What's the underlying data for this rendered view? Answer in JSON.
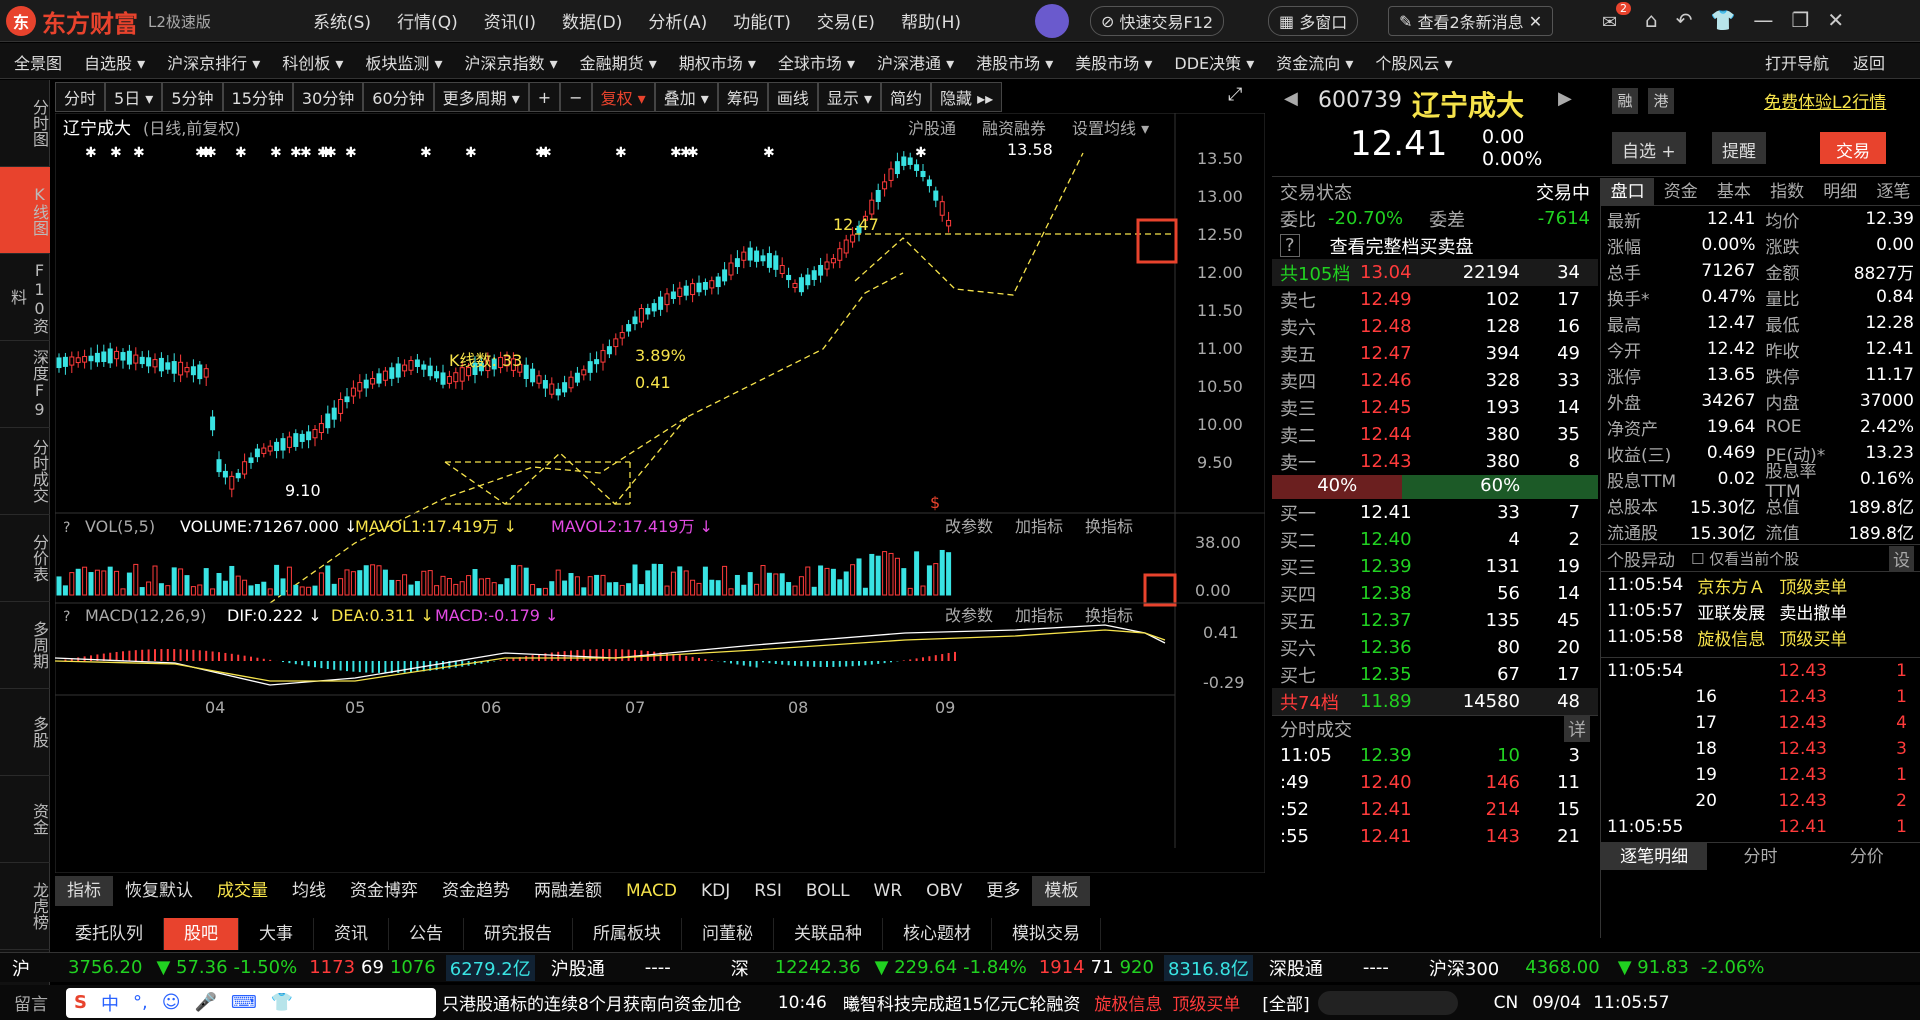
{
  "titlebar": {
    "brand": "东方财富",
    "edition": "L2极速版",
    "menus": [
      "系统(S)",
      "行情(Q)",
      "资讯(I)",
      "数据(D)",
      "分析(A)",
      "功能(T)",
      "交易(E)",
      "帮助(H)"
    ],
    "quick_trade": "快速交易F12",
    "multi_window": "多窗口",
    "news": "查看2条新消息",
    "badge": "2"
  },
  "navbar": [
    "全景图",
    "自选股 ▾",
    "沪深京排行 ▾",
    "科创板 ▾",
    "板块监测 ▾",
    "沪深京指数 ▾",
    "金融期货 ▾",
    "期权市场 ▾",
    "全球市场 ▾",
    "沪深港通 ▾",
    "港股市场 ▾",
    "美股市场 ▾",
    "DDE决策 ▾",
    "资金流向 ▾",
    "个股风云 ▾"
  ],
  "navbar_right": [
    "打开导航",
    "返回"
  ],
  "leftbar": [
    "分时图",
    "K线图",
    "F10资料",
    "深度F9",
    "分时成交",
    "分价表",
    "多周期",
    "多股",
    "资金",
    "龙虎榜"
  ],
  "chart_toolbar": [
    "分时",
    "5日 ▾",
    "5分钟",
    "15分钟",
    "30分钟",
    "60分钟",
    "更多周期 ▾",
    "+",
    "−",
    "复权 ▾",
    "叠加 ▾",
    "筹码",
    "画线",
    "显示 ▾",
    "简约",
    "隐藏 ▸▸"
  ],
  "chart_header": {
    "name": "辽宁成大",
    "mode": "(日线,前复权)",
    "links": [
      "沪股通",
      "融资融券",
      "设置均线 ▾"
    ]
  },
  "chart_data": {
    "type": "candlestick",
    "y_ticks": [
      "13.50",
      "13.00",
      "12.50",
      "12.00",
      "11.50",
      "11.00",
      "10.50",
      "10.00",
      "9.50"
    ],
    "x_ticks": [
      "04",
      "05",
      "06",
      "07",
      "08",
      "09"
    ],
    "annotations": [
      "13.58",
      "12.47",
      "K线数: 33",
      "3.89%",
      "0.41",
      "9.10"
    ],
    "high": 13.58,
    "low": 9.1
  },
  "vol_header": {
    "name": "VOL(5,5)",
    "volume": "VOLUME:71267.000 ↓",
    "ma1": "MAVOL1:17.419万 ↓",
    "ma2": "MAVOL2:17.419万 ↓",
    "actions": [
      "改参数",
      "加指标",
      "换指标"
    ]
  },
  "vol_axis": [
    "38.00",
    "0.00"
  ],
  "macd_header": {
    "name": "MACD(12,26,9)",
    "dif": "DIF:0.222 ↓",
    "dea": "DEA:0.311 ↓",
    "macd": "MACD:-0.179 ↓",
    "actions": [
      "改参数",
      "加指标",
      "换指标"
    ]
  },
  "macd_axis": [
    "0.41",
    "-0.29"
  ],
  "indicators": [
    "指标",
    "恢复默认",
    "成交量",
    "均线",
    "资金博弈",
    "资金趋势",
    "两融差额",
    "MACD",
    "KDJ",
    "RSI",
    "BOLL",
    "WR",
    "OBV",
    "更多",
    "模板"
  ],
  "bottom_tabs": [
    "委托队列",
    "股吧",
    "大事",
    "资讯",
    "公告",
    "研究报告",
    "所属板块",
    "问董秘",
    "关联品种",
    "核心题材",
    "模拟交易"
  ],
  "stock": {
    "code": "600739",
    "name": "辽宁成大",
    "price": "12.41",
    "chg": "0.00",
    "pct": "0.00%",
    "tags": [
      "融",
      "港"
    ],
    "free_l2": "免费体验L2行情",
    "btn_fav": "自选 +",
    "btn_remind": "提醒",
    "btn_trade": "交易"
  },
  "status": {
    "label": "交易状态",
    "value": "交易中",
    "weibi_label": "委比",
    "weibi": "-20.70%",
    "weicha_label": "委差",
    "weicha": "-7614",
    "full_book": "查看完整档买卖盘"
  },
  "sell_total": {
    "label": "共105档",
    "price": "13.04",
    "vol": "22194",
    "n": "34"
  },
  "asks": [
    [
      "卖七",
      "12.49",
      "102",
      "17"
    ],
    [
      "卖六",
      "12.48",
      "128",
      "16"
    ],
    [
      "卖五",
      "12.47",
      "394",
      "49"
    ],
    [
      "卖四",
      "12.46",
      "328",
      "33"
    ],
    [
      "卖三",
      "12.45",
      "193",
      "14"
    ],
    [
      "卖二",
      "12.44",
      "380",
      "35"
    ],
    [
      "卖一",
      "12.43",
      "380",
      "8"
    ]
  ],
  "ratio": {
    "sell": "40%",
    "buy": "60%"
  },
  "bids": [
    [
      "买一",
      "12.41",
      "33",
      "7"
    ],
    [
      "买二",
      "12.40",
      "4",
      "2"
    ],
    [
      "买三",
      "12.39",
      "131",
      "19"
    ],
    [
      "买四",
      "12.38",
      "56",
      "14"
    ],
    [
      "买五",
      "12.37",
      "135",
      "45"
    ],
    [
      "买六",
      "12.36",
      "80",
      "20"
    ],
    [
      "买七",
      "12.35",
      "67",
      "17"
    ]
  ],
  "buy_total": {
    "label": "共74档",
    "price": "11.89",
    "vol": "14580",
    "n": "48"
  },
  "ticks_title": "分时成交",
  "ticks_detail": "详",
  "ticks": [
    [
      "11:05",
      "12.39",
      "10",
      "3"
    ],
    [
      ":49",
      "12.40",
      "146",
      "11"
    ],
    [
      ":52",
      "12.41",
      "214",
      "15"
    ],
    [
      ":55",
      "12.41",
      "143",
      "21"
    ]
  ],
  "panel_tabs": [
    "盘口",
    "资金",
    "基本",
    "指数",
    "明细",
    "逐笔"
  ],
  "stats": [
    [
      "最新",
      "12.41",
      "均价",
      "12.39"
    ],
    [
      "涨幅",
      "0.00%",
      "涨跌",
      "0.00"
    ],
    [
      "总手",
      "71267",
      "金额",
      "8827万"
    ],
    [
      "换手*",
      "0.47%",
      "量比",
      "0.84"
    ],
    [
      "最高",
      "12.47",
      "最低",
      "12.28"
    ],
    [
      "今开",
      "12.42",
      "昨收",
      "12.41"
    ],
    [
      "涨停",
      "13.65",
      "跌停",
      "11.17"
    ],
    [
      "外盘",
      "34267",
      "内盘",
      "37000"
    ],
    [
      "净资产",
      "19.64",
      "ROE",
      "2.42%"
    ],
    [
      "收益(三)",
      "0.469",
      "PE(动)*",
      "13.23"
    ],
    [
      "股息TTM",
      "0.02",
      "股息率TTM",
      "0.16%"
    ],
    [
      "总股本",
      "15.30亿",
      "总值",
      "189.8亿"
    ],
    [
      "流通股",
      "15.30亿",
      "流值",
      "189.8亿"
    ]
  ],
  "alerts_title": "个股异动",
  "alerts_only": "仅看当前个股",
  "alerts_set": "设",
  "alerts": [
    [
      "11:05:54",
      "京东方Ａ",
      "顶级卖单"
    ],
    [
      "11:05:57",
      "亚联发展",
      "卖出撤单"
    ],
    [
      "11:05:58",
      "旋极信息",
      "顶级买单"
    ]
  ],
  "tradelist": [
    [
      "11:05:54",
      "12.43",
      "1"
    ],
    [
      "16",
      "12.43",
      "1"
    ],
    [
      "17",
      "12.43",
      "4"
    ],
    [
      "18",
      "12.43",
      "3"
    ],
    [
      "19",
      "12.43",
      "1"
    ],
    [
      "20",
      "12.43",
      "2"
    ],
    [
      "11:05:55",
      "12.41",
      "1"
    ]
  ],
  "right_bottom_tabs": [
    "逐笔明细",
    "分时",
    "分价"
  ],
  "status_bar": {
    "sh": "沪",
    "sh_idx": "3756.20",
    "sh_chg": "▼ 57.36",
    "sh_pct": "-1.50%",
    "sh_up": "1173",
    "sh_flat": "69",
    "sh_dn": "1076",
    "sh_amt": "6279.2亿",
    "hgt": "沪股通",
    "hgt_v": "----",
    "sz": "深",
    "sz_idx": "12242.36",
    "sz_chg": "▼ 229.64",
    "sz_pct": "-1.84%",
    "sz_up": "1914",
    "sz_flat": "71",
    "sz_dn": "920",
    "sz_amt": "8316.8亿",
    "sgt": "深股通",
    "sgt_v": "----",
    "hs300": "沪深300",
    "hs300_v": "4368.00",
    "hs300_chg": "▼ 91.83",
    "hs300_pct": "-2.06%"
  },
  "ticker": {
    "msg": "留言",
    "news": "只港股通标的连续8个月获南向资金加仓",
    "time": "10:46",
    "news2": "曦智科技完成超15亿元C轮融资",
    "alert1": "旋极信息",
    "alert2": "顶级买单",
    "all": "[全部]",
    "lang": "CN",
    "date": "09/04",
    "clock": "11:05:57"
  }
}
